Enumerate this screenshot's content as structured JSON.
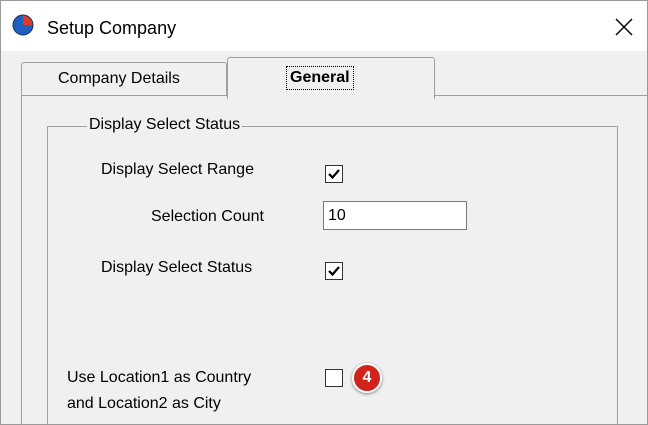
{
  "window": {
    "title": "Setup Company",
    "close_label": "×"
  },
  "tabs": [
    {
      "label": "Company Details",
      "active": false
    },
    {
      "label": "General",
      "active": true
    }
  ],
  "group": {
    "legend": "Display Select Status"
  },
  "fields": {
    "display_select_range": {
      "label": "Display Select Range",
      "checked": true
    },
    "selection_count": {
      "label": "Selection Count",
      "value": "10"
    },
    "display_select_status": {
      "label": "Display Select Status",
      "checked": true
    },
    "use_location": {
      "label_line1": "Use Location1 as Country",
      "label_line2": "and Location2 as City",
      "checked": false
    }
  },
  "annotation": {
    "badge_number": "4",
    "badge_color": "#d0231c"
  },
  "colors": {
    "window_bg": "#ffffff",
    "dialog_bg": "#f0f0f0",
    "border": "#a0a0a0"
  },
  "icons": {
    "app": "blue-red-globe-icon",
    "close": "close-icon",
    "check": "checkmark-icon"
  }
}
